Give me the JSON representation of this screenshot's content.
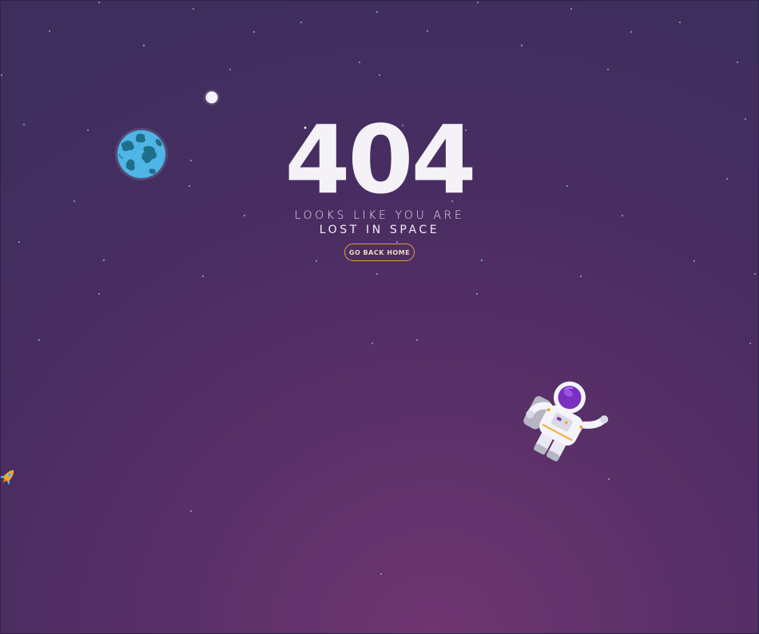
{
  "error": {
    "code": "404",
    "line1": "LOOKS LIKE YOU ARE",
    "line2": "LOST IN SPACE",
    "home_button_label": "GO BACK HOME"
  },
  "icons": [
    "moon-icon",
    "earth-icon",
    "astronaut-icon",
    "rocket-icon"
  ],
  "colors": {
    "background_top": "#3e2e5e",
    "background_bottom": "#6e3571",
    "button_border": "#e0a33f",
    "title": "#f4f2f7"
  }
}
